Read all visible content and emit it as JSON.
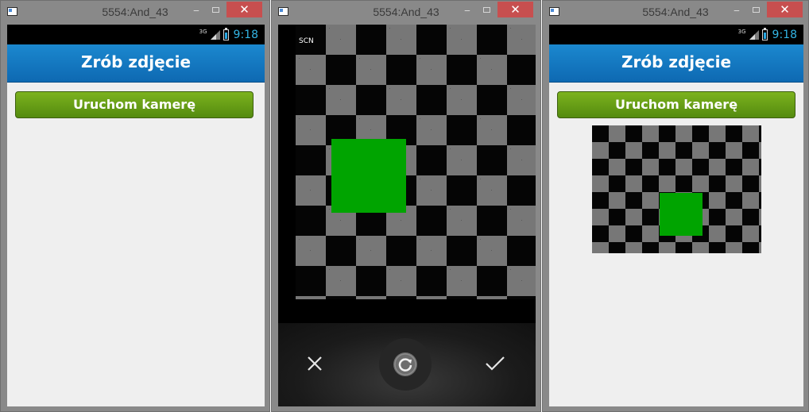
{
  "windows": [
    {
      "title": "5554:And_43",
      "min_label": "‒",
      "close_label": "✕",
      "status": {
        "network": "3G",
        "time": "9:18"
      },
      "action_bar_title": "Zrób zdjęcie",
      "button_label": "Uruchom kamerę"
    },
    {
      "title": "5554:And_43",
      "min_label": "‒",
      "close_label": "✕",
      "camera": {
        "scene_mode": "SCN",
        "controls": [
          "cancel-icon",
          "retake-icon",
          "confirm-icon"
        ]
      }
    },
    {
      "title": "5554:And_43",
      "min_label": "‒",
      "close_label": "✕",
      "status": {
        "network": "3G",
        "time": "9:18"
      },
      "action_bar_title": "Zrób zdjęcie",
      "button_label": "Uruchom kamerę"
    }
  ],
  "colors": {
    "action_bar": "#1275bf",
    "button_green": "#6aa117",
    "square_green": "#00a400",
    "close_red": "#c74f4f",
    "clock_blue": "#33b5e5"
  }
}
